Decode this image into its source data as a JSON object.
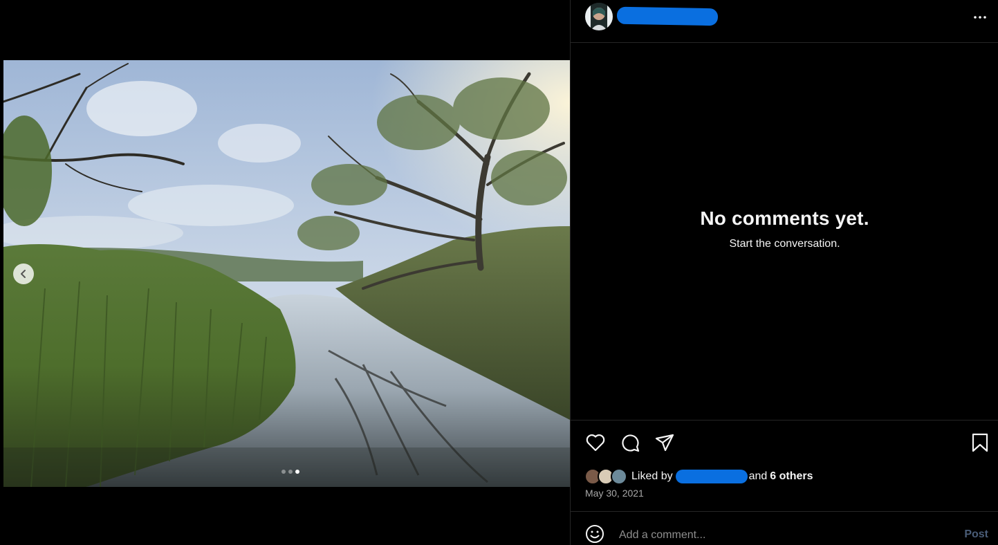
{
  "post": {
    "empty_title": "No comments yet.",
    "empty_subtitle": "Start the conversation.",
    "likes_prefix": "Liked by",
    "likes_and": "and",
    "likes_others": "6 others",
    "date": "May 30, 2021"
  },
  "carousel": {
    "slide_count": 3,
    "active_slide": 3
  },
  "comment_box": {
    "placeholder": "Add a comment...",
    "post_label": "Post"
  },
  "icons": {
    "more": "more-horizontal-icon",
    "like": "heart-icon",
    "comment": "comment-bubble-icon",
    "share": "paper-plane-icon",
    "save": "bookmark-icon",
    "emoji": "smiley-icon",
    "prev": "chevron-left-icon"
  },
  "colors": {
    "background": "#000000",
    "divider": "#262626",
    "redaction": "#0a6fe0",
    "post_disabled": "#4a5d78",
    "muted_text": "#a8a8a8"
  }
}
